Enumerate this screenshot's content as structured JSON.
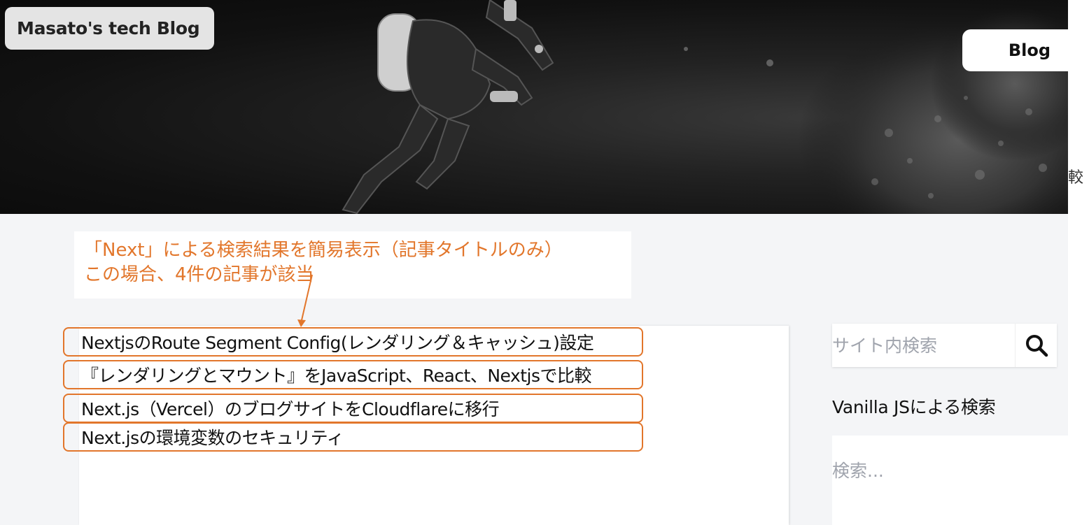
{
  "header": {
    "site_title": "Masato's tech Blog",
    "nav_blog": "Blog",
    "edge_glyph": "較"
  },
  "annotation": {
    "line1": "「Next」による検索結果を簡易表示（記事タイトルのみ）",
    "line2": "この場合、4件の記事が該当"
  },
  "results": [
    "NextjsのRoute Segment Config(レンダリング＆キャッシュ)設定",
    "『レンダリングとマウント』をJavaScript、React、Nextjsで比較",
    "Next.js（Vercel）のブログサイトをCloudflareに移行",
    "Next.jsの環境変数のセキュリティ"
  ],
  "sidebar": {
    "search_placeholder": "サイト内検索",
    "vanilla_heading": "Vanilla JSによる検索",
    "vanilla_placeholder": "検索..."
  },
  "colors": {
    "annotation": "#e2762b",
    "content_bg": "#f4f5f7"
  },
  "icons": {
    "search": "search-icon"
  }
}
